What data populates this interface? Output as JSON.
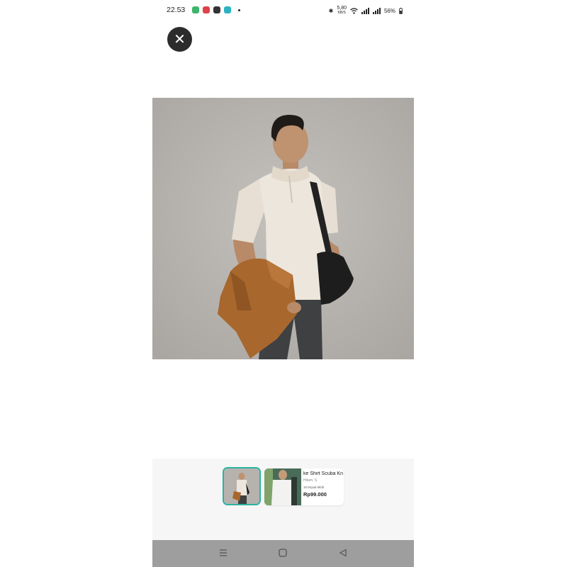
{
  "status_bar": {
    "time": "22.53",
    "network_speed": "5,80",
    "network_unit": "KB/S",
    "battery": "56%",
    "app_icons": [
      "app-icon-green",
      "app-icon-red",
      "app-icon-dark",
      "app-icon-teal"
    ],
    "app_icon_colors": [
      "#3db56b",
      "#e0424a",
      "#333333",
      "#2bb3c0"
    ]
  },
  "close_button": {
    "label": "✕",
    "icon": "close-icon"
  },
  "product_photo": {
    "subject": "man-in-cream-polo-shirt-with-bag"
  },
  "thumbnails": [
    {
      "name": "thumbnail-product-1",
      "selected": true
    },
    {
      "name": "thumbnail-product-2",
      "selected": false
    }
  ],
  "product_card": {
    "title": "ke Shirt Scuba Kn",
    "variant": "Hitam, S",
    "sold": "10 terjual lebih",
    "price": "Rp99.000"
  },
  "nav_bar": {
    "icons": [
      "menu-icon",
      "home-icon",
      "back-icon"
    ]
  },
  "colors": {
    "accent": "#2bb3a0",
    "close_bg": "#2c2c2c",
    "nav_bar": "#9e9e9e",
    "strip_bg": "#f6f6f6"
  }
}
